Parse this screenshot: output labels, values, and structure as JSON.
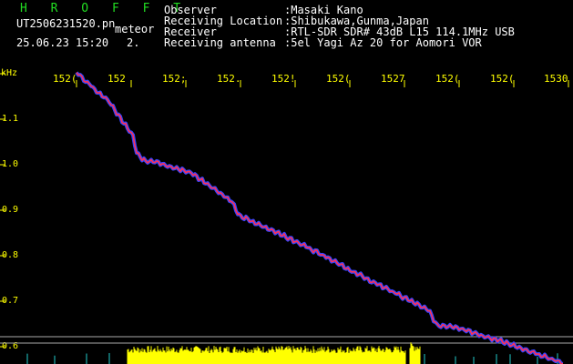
{
  "header": {
    "program": "H R O F F T",
    "filename": "UT2506231520.pn",
    "meteor_label": "meteor",
    "datetime": "25.06.23 15:20",
    "index": "2.",
    "fields": [
      {
        "label": "Observer",
        "value": ":Masaki Kano"
      },
      {
        "label": "Receiving Location",
        "value": ":Shibukawa,Gunma,Japan"
      },
      {
        "label": "Receiver",
        "value": ":RTL-SDR SDR# 43dB L15 114.1MHz USB"
      },
      {
        "label": "Receiving antenna",
        "value": ":5el Yagi Az 20 for Aomori VOR"
      }
    ]
  },
  "time_axis": {
    "tick_labels": [
      "152(",
      "152",
      "152;",
      "152.",
      "152!",
      "152(",
      "1527",
      "152(",
      "152(",
      "1530"
    ]
  },
  "freq_axis": {
    "unit": "kHz",
    "tick_labels": [
      "1.1",
      "1.0",
      "0.9",
      "0.8",
      "0.7",
      "0.6"
    ]
  },
  "colors": {
    "background": "#000000",
    "axis_text": "#ffff00",
    "header_text": "#ffffff",
    "title_text": "#22dd22",
    "trace_core": "#ff3355",
    "trace_edge": "#3344ff",
    "noise_band": "#ffff00",
    "baseline": "#aaaaaa",
    "cyan_noise": "#22cccc"
  }
}
